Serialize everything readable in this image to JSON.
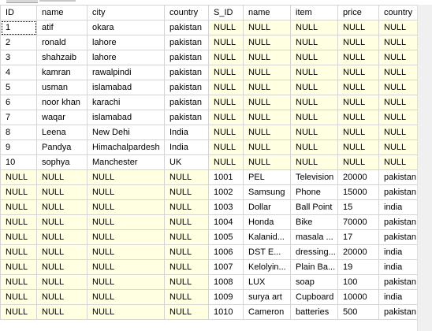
{
  "columns": [
    "ID",
    "name",
    "city",
    "country",
    "S_ID",
    "name",
    "item",
    "price",
    "country"
  ],
  "rows": [
    [
      "1",
      "atif",
      "okara",
      "pakistan",
      "NULL",
      "NULL",
      "NULL",
      "NULL",
      "NULL"
    ],
    [
      "2",
      "ronald",
      "lahore",
      "pakistan",
      "NULL",
      "NULL",
      "NULL",
      "NULL",
      "NULL"
    ],
    [
      "3",
      "shahzaib",
      "lahore",
      "pakistan",
      "NULL",
      "NULL",
      "NULL",
      "NULL",
      "NULL"
    ],
    [
      "4",
      "kamran",
      "rawalpindi",
      "pakistan",
      "NULL",
      "NULL",
      "NULL",
      "NULL",
      "NULL"
    ],
    [
      "5",
      "usman",
      "islamabad",
      "pakistan",
      "NULL",
      "NULL",
      "NULL",
      "NULL",
      "NULL"
    ],
    [
      "6",
      "noor khan",
      "karachi",
      "pakistan",
      "NULL",
      "NULL",
      "NULL",
      "NULL",
      "NULL"
    ],
    [
      "7",
      "waqar",
      "islamabad",
      "pakistan",
      "NULL",
      "NULL",
      "NULL",
      "NULL",
      "NULL"
    ],
    [
      "8",
      "Leena",
      "New Dehi",
      "India",
      "NULL",
      "NULL",
      "NULL",
      "NULL",
      "NULL"
    ],
    [
      "9",
      "Pandya",
      "Himachalpardesh",
      "India",
      "NULL",
      "NULL",
      "NULL",
      "NULL",
      "NULL"
    ],
    [
      "10",
      "sophya",
      "Manchester",
      "UK",
      "NULL",
      "NULL",
      "NULL",
      "NULL",
      "NULL"
    ],
    [
      "NULL",
      "NULL",
      "NULL",
      "NULL",
      "1001",
      "PEL",
      "Television",
      "20000",
      "pakistan"
    ],
    [
      "NULL",
      "NULL",
      "NULL",
      "NULL",
      "1002",
      "Samsung",
      "Phone",
      "15000",
      "pakistan"
    ],
    [
      "NULL",
      "NULL",
      "NULL",
      "NULL",
      "1003",
      "Dollar",
      "Ball Point",
      "15",
      "india"
    ],
    [
      "NULL",
      "NULL",
      "NULL",
      "NULL",
      "1004",
      "Honda",
      "Bike",
      "70000",
      "pakistan"
    ],
    [
      "NULL",
      "NULL",
      "NULL",
      "NULL",
      "1005",
      "Kalanid...",
      "masala ...",
      "17",
      "pakistan"
    ],
    [
      "NULL",
      "NULL",
      "NULL",
      "NULL",
      "1006",
      "DST E...",
      "dressing...",
      "20000",
      "india"
    ],
    [
      "NULL",
      "NULL",
      "NULL",
      "NULL",
      "1007",
      "Kelolyin...",
      "Plain Ba...",
      "19",
      "india"
    ],
    [
      "NULL",
      "NULL",
      "NULL",
      "NULL",
      "1008",
      "LUX",
      "soap",
      "100",
      "pakistan"
    ],
    [
      "NULL",
      "NULL",
      "NULL",
      "NULL",
      "1009",
      "surya art",
      "Cupboard",
      "10000",
      "india"
    ],
    [
      "NULL",
      "NULL",
      "NULL",
      "NULL",
      "1010",
      "Cameron",
      "batteries",
      "500",
      "pakistan"
    ]
  ],
  "colors": {
    "null_cell": "#ffffe1",
    "gridline": "#d4d4d4"
  }
}
